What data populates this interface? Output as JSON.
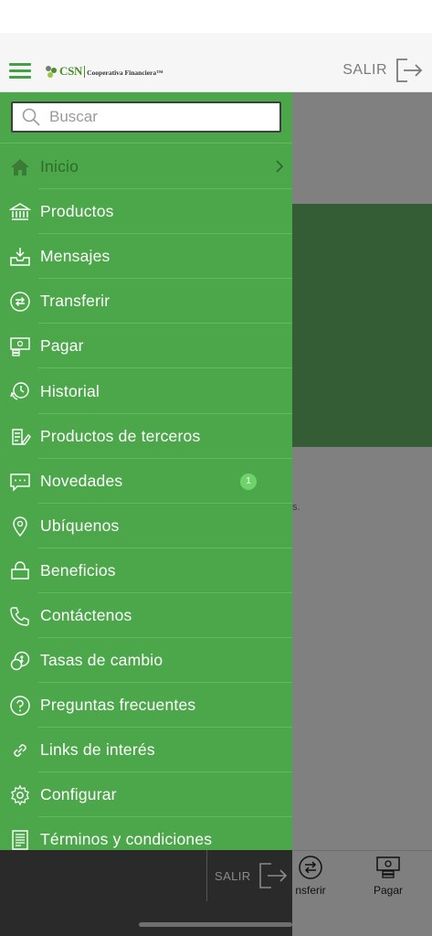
{
  "header": {
    "logo_name": "CSN",
    "logo_subtitle": "Cooperativa Financiera™",
    "logout_label": "SALIR"
  },
  "search": {
    "placeholder": "Buscar"
  },
  "menu": [
    {
      "label": "Inicio",
      "icon": "home-icon"
    },
    {
      "label": "Productos",
      "icon": "bank-icon"
    },
    {
      "label": "Mensajes",
      "icon": "inbox-icon"
    },
    {
      "label": "Transferir",
      "icon": "transfer-icon"
    },
    {
      "label": "Pagar",
      "icon": "pay-icon"
    },
    {
      "label": "Historial",
      "icon": "history-icon"
    },
    {
      "label": "Productos de terceros",
      "icon": "third-party-products-icon"
    },
    {
      "label": "Novedades",
      "icon": "news-icon",
      "badge": "1"
    },
    {
      "label": "Ubíquenos",
      "icon": "location-pin-icon"
    },
    {
      "label": "Beneficios",
      "icon": "bag-icon"
    },
    {
      "label": "Contáctenos",
      "icon": "phone-icon"
    },
    {
      "label": "Tasas de cambio",
      "icon": "exchange-rate-icon"
    },
    {
      "label": "Preguntas frecuentes",
      "icon": "question-icon"
    },
    {
      "label": "Links de interés",
      "icon": "link-icon"
    },
    {
      "label": "Configurar",
      "icon": "gear-icon"
    },
    {
      "label": "Términos y condiciones",
      "icon": "document-icon"
    }
  ],
  "background": {
    "snippet": "s.",
    "tabs": [
      {
        "label": "nsferir"
      },
      {
        "label": "Pagar"
      }
    ]
  },
  "drawer_footer": {
    "logout_label": "SALIR"
  },
  "colors": {
    "drawer_green": "#4ca74a",
    "accent_green": "#43a047",
    "badge_green": "#6ed36a",
    "active_item": "#2f6b2b"
  }
}
